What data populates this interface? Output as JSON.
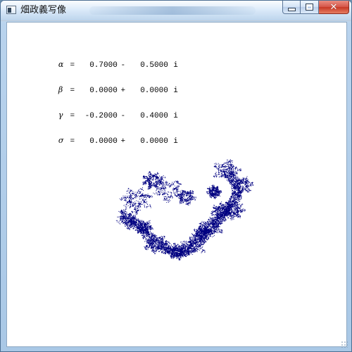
{
  "window": {
    "title": "畑政義写像",
    "controls": {
      "minimize_label": "",
      "maximize_label": "",
      "close_label": "✕"
    }
  },
  "parameters": [
    {
      "symbol": "α",
      "equals": "=",
      "real": "0.7000",
      "operator": "-",
      "imaginary": "0.5000",
      "unit": "i"
    },
    {
      "symbol": "β",
      "equals": "=",
      "real": "0.0000",
      "operator": "+",
      "imaginary": "0.0000",
      "unit": "i"
    },
    {
      "symbol": "γ",
      "equals": "=",
      "real": "-0.2000",
      "operator": "-",
      "imaginary": "0.4000",
      "unit": "i"
    },
    {
      "symbol": "σ",
      "equals": "=",
      "real": "0.0000",
      "operator": "+",
      "imaginary": "0.0000",
      "unit": "i"
    }
  ],
  "fractal": {
    "point_color": "#000080",
    "background_color": "#ffffff"
  },
  "icons": {
    "app": "window-app-icon",
    "minimize": "minimize-icon",
    "maximize": "maximize-icon",
    "close": "close-icon",
    "resize": "resize-grip-icon"
  }
}
